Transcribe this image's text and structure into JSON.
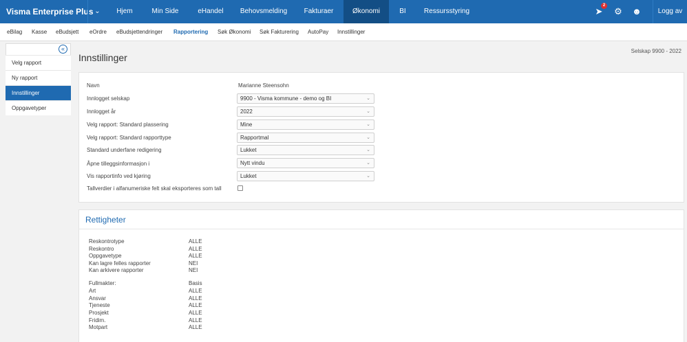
{
  "brand": "Visma Enterprise Plus",
  "top_nav": [
    "Hjem",
    "Min Side",
    "eHandel",
    "Behovsmelding",
    "Fakturaer",
    "Økonomi",
    "BI",
    "Ressursstyring"
  ],
  "notification_count": "2",
  "logout": "Logg av",
  "sub_nav": [
    "eBilag",
    "Kasse",
    "eBudsjett",
    "eOrdre",
    "eBudsjettendringer",
    "Rapportering",
    "Søk Økonomi",
    "Søk Fakturering",
    "AutoPay",
    "Innstillinger"
  ],
  "sidebar": [
    "Velg rapport",
    "Ny rapport",
    "Innstillinger",
    "Oppgavetyper"
  ],
  "page_title": "Innstillinger",
  "company": "Selskap 9900 - 2022",
  "settings": {
    "name_label": "Navn",
    "name_value": "Marianne Steensohn",
    "rows": [
      {
        "label": "Innlogget selskap",
        "value": "9900 - Visma kommune - demo og BI"
      },
      {
        "label": "Innlogget år",
        "value": "2022"
      },
      {
        "label": "Velg rapport: Standard plassering",
        "value": "Mine"
      },
      {
        "label": "Velg rapport: Standard rapporttype",
        "value": "Rapportmal"
      },
      {
        "label": "Standard underfane redigering",
        "value": "Lukket"
      },
      {
        "label": "Åpne tilleggsinformasjon i",
        "value": "Nytt vindu"
      },
      {
        "label": "Vis rapportinfo ved kjøring",
        "value": "Lukket"
      }
    ],
    "checkbox_label": "Tallverdier i alfanumeriske felt skal eksporteres som tall"
  },
  "rights": {
    "title": "Rettigheter",
    "group1": [
      {
        "label": "Reskontrotype",
        "value": "ALLE"
      },
      {
        "label": "Reskontro",
        "value": "ALLE"
      },
      {
        "label": "Oppgavetype",
        "value": "ALLE"
      },
      {
        "label": "Kan lagre felles rapporter",
        "value": "NEI"
      },
      {
        "label": "Kan arkivere rapporter",
        "value": "NEI"
      }
    ],
    "group2": [
      {
        "label": "Fullmakter:",
        "value": "Basis"
      },
      {
        "label": "Art",
        "value": "ALLE"
      },
      {
        "label": "Ansvar",
        "value": "ALLE"
      },
      {
        "label": "Tjeneste",
        "value": "ALLE"
      },
      {
        "label": "Prosjekt",
        "value": "ALLE"
      },
      {
        "label": "Fridim.",
        "value": "ALLE"
      },
      {
        "label": "Motpart",
        "value": "ALLE"
      }
    ]
  },
  "colors": {
    "accent": "#1f6ab1",
    "active_nav": "#134e85",
    "badge": "#e0302f"
  }
}
